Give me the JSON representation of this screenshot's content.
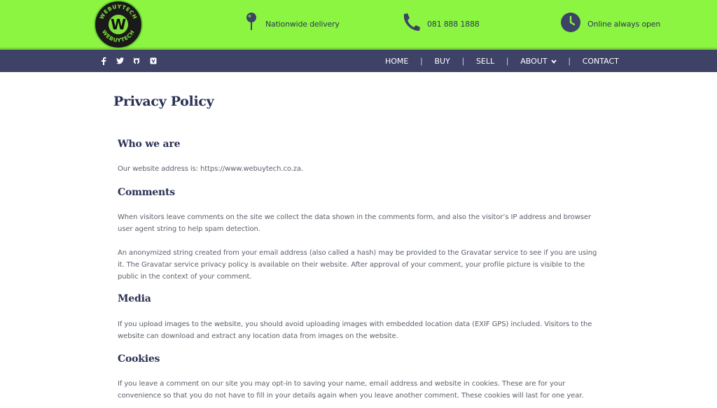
{
  "header": {
    "logo_text": "WEBUYTECH",
    "logo_letter": "W",
    "delivery": {
      "icon": "map-pin-icon",
      "label": "Nationwide delivery"
    },
    "phone": {
      "icon": "phone-icon",
      "label": "081 888 1888"
    },
    "hours": {
      "icon": "clock-icon",
      "label": "Online always open"
    }
  },
  "social": [
    "facebook-icon",
    "twitter-icon",
    "github-icon",
    "bandcamp-icon"
  ],
  "nav": {
    "home": "HOME",
    "buy": "BUY",
    "sell": "SELL",
    "about": "ABOUT",
    "contact": "CONTACT"
  },
  "page": {
    "title": "Privacy Policy",
    "sections": [
      {
        "heading": "Who we are",
        "paragraphs": [
          "Our website address is: https://www.webuytech.co.za."
        ]
      },
      {
        "heading": "Comments",
        "paragraphs": [
          "When visitors leave comments on the site we collect the data shown in the comments form, and also the visitor’s IP address and browser user agent string to help spam detection.",
          "An anonymized string created from your email address (also called a hash) may be provided to the Gravatar service to see if you are using it. The Gravatar service privacy policy is available on their website. After approval of your comment, your profile picture is visible to the public in the context of your comment."
        ]
      },
      {
        "heading": "Media",
        "paragraphs": [
          "If you upload images to the website, you should avoid uploading images with embedded location data (EXIF GPS) included. Visitors to the website can download and extract any location data from images on the website."
        ]
      },
      {
        "heading": "Cookies",
        "paragraphs": [
          "If you leave a comment on our site you may opt-in to saving your name, email address and website in cookies. These are for your convenience so that you do not have to fill in your details again when you leave another comment. These cookies will last for one year."
        ]
      }
    ]
  },
  "colors": {
    "header_bg": "#8cf542",
    "nav_bg": "#3d4266",
    "heading": "#2a3154",
    "body_text": "#5a5f6b"
  }
}
